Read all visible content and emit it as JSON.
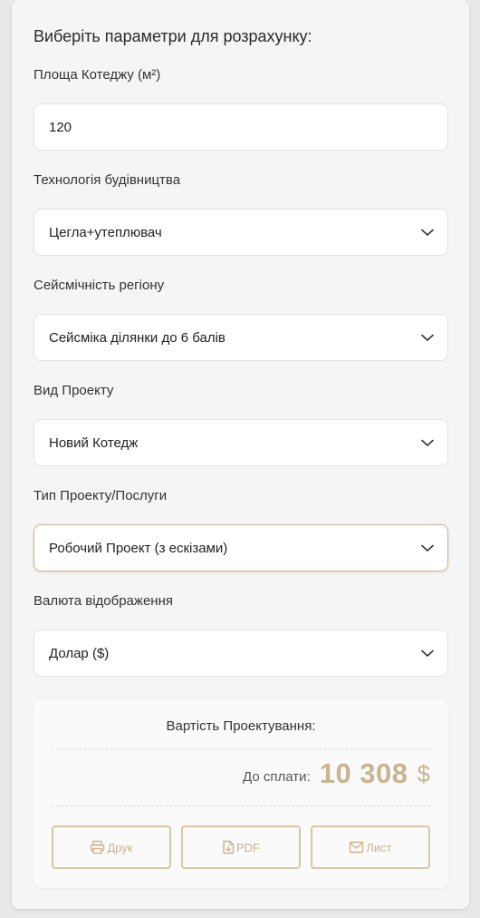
{
  "form": {
    "heading": "Виберіть параметри для розрахунку:",
    "area": {
      "label": "Площа Котеджу (м²)",
      "value": "120"
    },
    "technology": {
      "label": "Технологія будівництва",
      "value": "Цегла+утеплювач"
    },
    "seismic": {
      "label": "Сейсмічність регіону",
      "value": "Сейсміка ділянки до 6 балів"
    },
    "project_kind": {
      "label": "Вид Проекту",
      "value": "Новий Котедж"
    },
    "project_type": {
      "label": "Тип Проекту/Послуги",
      "value": "Робочий Проект (з ескізами)"
    },
    "currency": {
      "label": "Валюта відображення",
      "value": "Долар ($)"
    }
  },
  "result": {
    "title": "Вартість Проектування:",
    "pay_label": "До сплати:",
    "amount": "10 308",
    "currency_symbol": "$"
  },
  "actions": {
    "print_label": "Друк",
    "pdf_label": "PDF",
    "mail_label": "Лист"
  },
  "icons": {
    "select": "chevron-down-icon",
    "print": "printer-icon",
    "pdf": "file-pdf-icon",
    "mail": "envelope-icon"
  },
  "colors": {
    "accent": "#c8b48e",
    "card_bg": "#f5f5f5",
    "field_bg": "#ffffff"
  }
}
